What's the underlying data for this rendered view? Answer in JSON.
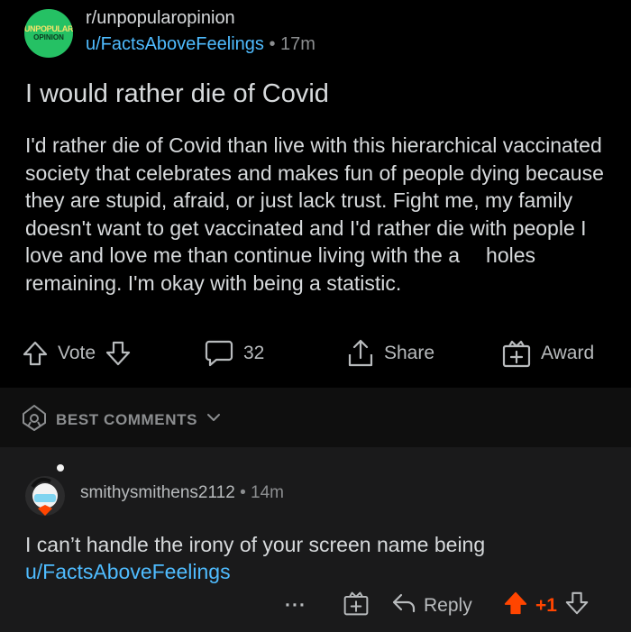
{
  "post": {
    "subreddit": "r/unpopularopinion",
    "subreddit_icon": {
      "line1": "UNPOPULAR",
      "line2": "OPINION"
    },
    "author": "u/FactsAboveFeelings",
    "separator": "•",
    "age": "17m",
    "title": "I would rather die of Covid",
    "body_before_censor": "I'd rather die of Covid than live with this hierarchical vaccinated society that celebrates and makes fun of people dying because they are stupid, afraid, or just lack trust. Fight me, my family doesn't want to get vaccinated and I'd rather die with people I love and love me than continue living with the a",
    "body_after_censor": "holes remaining. I'm okay with being a statistic."
  },
  "actions": {
    "vote_label": "Vote",
    "comment_count": "32",
    "share_label": "Share",
    "award_label": "Award"
  },
  "best_comments": {
    "label": "BEST COMMENTS"
  },
  "comment": {
    "author": "smithysmithens2112",
    "separator": "•",
    "age": "14m",
    "text_prefix": "I can’t handle the irony of your screen name being ",
    "text_link": "u/FactsAboveFeelings",
    "more_label": "···",
    "reply_label": "Reply",
    "score": "+1"
  },
  "colors": {
    "background": "#000000",
    "comment_bg": "#1a1a1b",
    "link": "#4fbcff",
    "upvote": "#ff4500",
    "subreddit_icon_bg": "#25c164"
  },
  "icons": [
    "upvote-arrow-icon",
    "downvote-arrow-icon",
    "comment-bubble-icon",
    "share-icon",
    "award-gift-icon",
    "shield-icon",
    "chevron-down-icon",
    "more-dots-icon",
    "reply-arrow-icon"
  ]
}
